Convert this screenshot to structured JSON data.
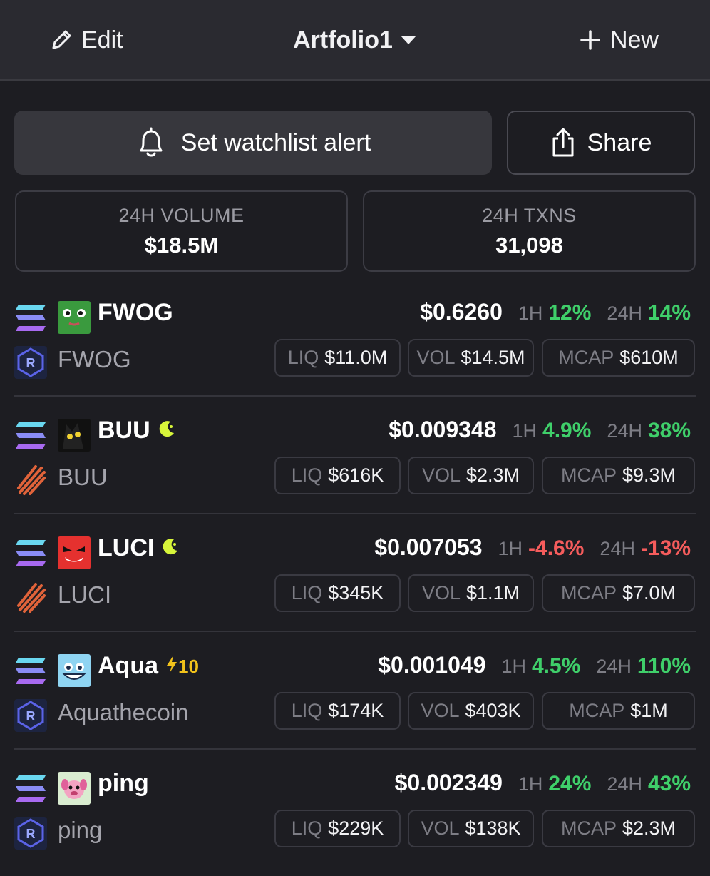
{
  "header": {
    "edit_label": "Edit",
    "title": "Artfolio1",
    "new_label": "New"
  },
  "actions": {
    "alert_label": "Set watchlist alert",
    "share_label": "Share"
  },
  "stats": {
    "volume": {
      "label": "24H VOLUME",
      "value": "$18.5M"
    },
    "txns": {
      "label": "24H TXNS",
      "value": "31,098"
    }
  },
  "labels": {
    "h1": "1H",
    "h24": "24H",
    "liq": "LIQ",
    "vol": "VOL",
    "mcap": "MCAP"
  },
  "colors": {
    "green": "#3fcf6a",
    "red": "#f55c5c",
    "moon": "#d7f53a",
    "bolt": "#f2c21b"
  },
  "tokens": [
    {
      "symbol": "FWOG",
      "name": "FWOG",
      "price": "$0.6260",
      "h1": "12%",
      "h24": "14%",
      "liq": "$11.0M",
      "vol": "$14.5M",
      "mcap": "$610M",
      "dex": "raydium-icon",
      "badge": ""
    },
    {
      "symbol": "BUU",
      "name": "BUU",
      "price": "$0.009348",
      "h1": "4.9%",
      "h24": "38%",
      "liq": "$616K",
      "vol": "$2.3M",
      "mcap": "$9.3M",
      "dex": "pumpfun-icon",
      "badge": "moon"
    },
    {
      "symbol": "LUCI",
      "name": "LUCI",
      "price": "$0.007053",
      "h1": "-4.6%",
      "h24": "-13%",
      "liq": "$345K",
      "vol": "$1.1M",
      "mcap": "$7.0M",
      "dex": "pumpfun-icon",
      "badge": "moon"
    },
    {
      "symbol": "Aqua",
      "name": "Aquathecoin",
      "price": "$0.001049",
      "h1": "4.5%",
      "h24": "110%",
      "liq": "$174K",
      "vol": "$403K",
      "mcap": "$1M",
      "dex": "raydium-icon",
      "badge": "10"
    },
    {
      "symbol": "ping",
      "name": "ping",
      "price": "$0.002349",
      "h1": "24%",
      "h24": "43%",
      "liq": "$229K",
      "vol": "$138K",
      "mcap": "$2.3M",
      "dex": "raydium-icon",
      "badge": ""
    }
  ]
}
